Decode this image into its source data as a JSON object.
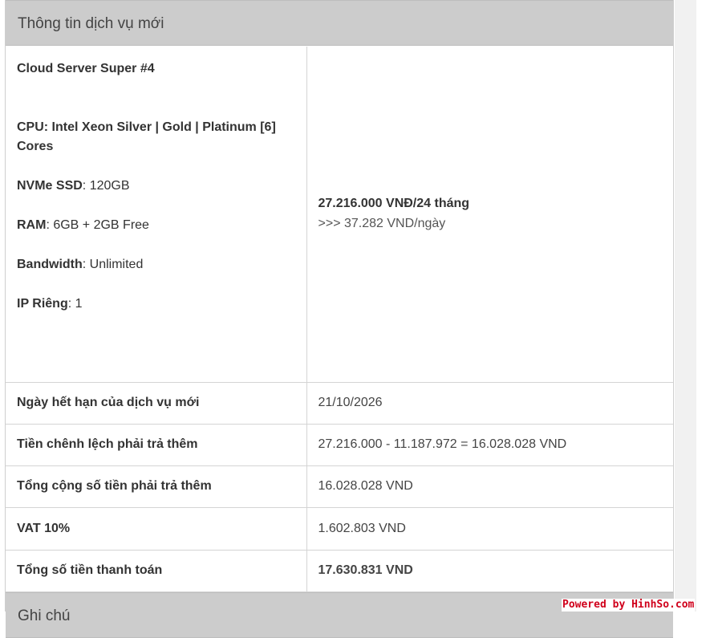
{
  "header": {
    "title": "Thông tin dịch vụ mới"
  },
  "service": {
    "name": "Cloud Server Super #4",
    "cpu": "CPU: Intel Xeon Silver | Gold | Platinum [6] Cores",
    "nvme_label": "NVMe SSD",
    "nvme_value": ": 120GB",
    "ram_label": "RAM",
    "ram_value": ": 6GB + 2GB Free",
    "bandwidth_label": "Bandwidth",
    "bandwidth_value": ": Unlimited",
    "ip_label": "IP Riêng",
    "ip_value": ": 1",
    "price": "27.216.000 VNĐ/24 tháng",
    "price_per_day": ">>> 37.282 VND/ngày"
  },
  "rows": [
    {
      "label": "Ngày hết hạn của dịch vụ mới",
      "value": "21/10/2026"
    },
    {
      "label": "Tiền chênh lệch phải trả thêm",
      "value": "27.216.000 - 11.187.972 = 16.028.028 VND"
    },
    {
      "label": "Tổng cộng số tiền phải trả thêm",
      "value": "16.028.028 VND"
    },
    {
      "label": "VAT 10%",
      "value": "1.602.803 VND"
    },
    {
      "label": "Tổng số tiền thanh toán",
      "value": "17.630.831 VND"
    }
  ],
  "next_section": {
    "title": "Ghi chú"
  },
  "watermark": "Powered by HinhSo.com",
  "colors": {
    "total": "#d0144e",
    "header_bg": "#cccccc",
    "watermark": "#d0001b"
  }
}
